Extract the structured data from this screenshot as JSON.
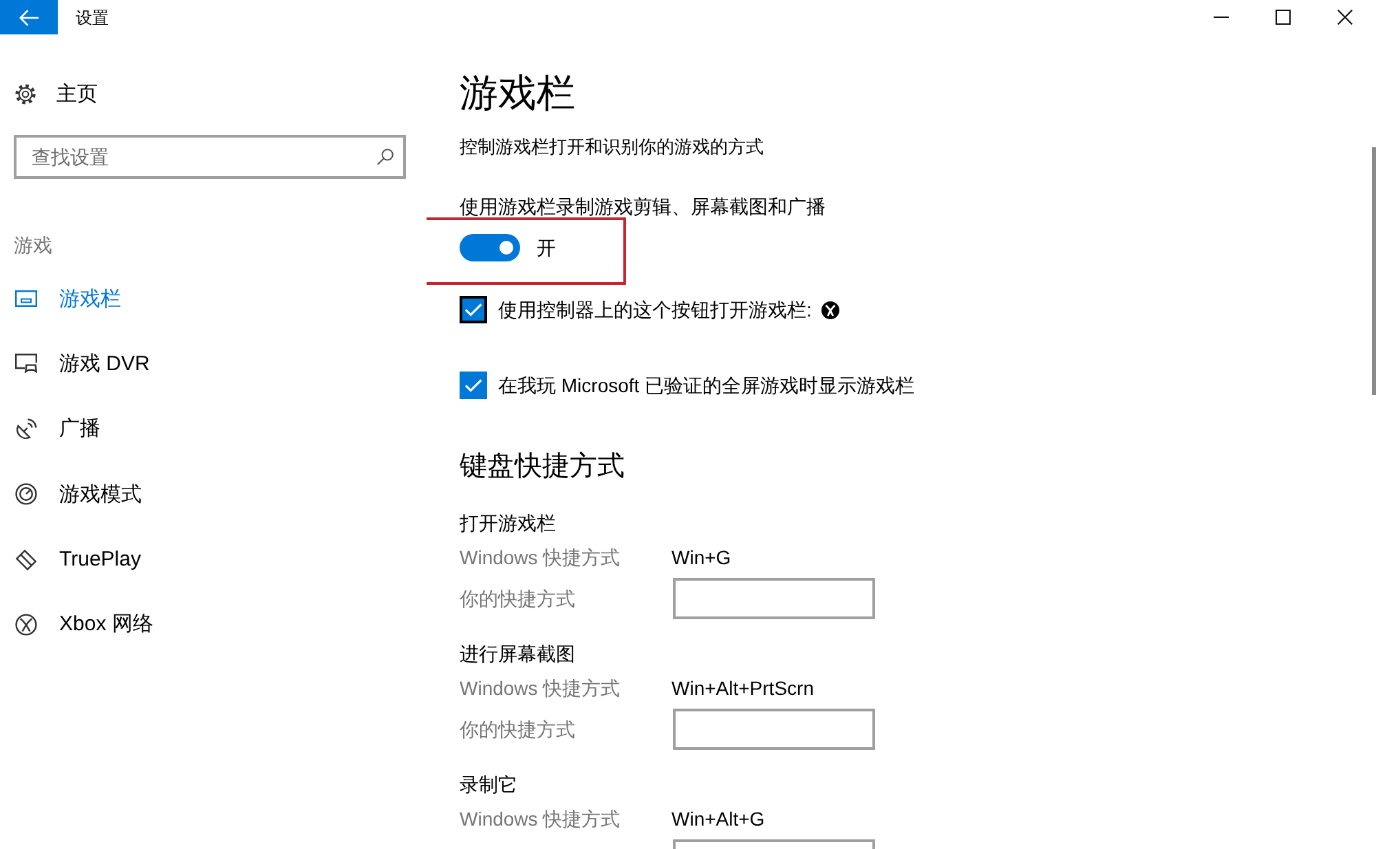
{
  "window": {
    "title": "设置"
  },
  "sidebar": {
    "home": "主页",
    "search": {
      "placeholder": "查找设置"
    },
    "section": "游戏",
    "items": [
      {
        "label": "游戏栏",
        "selected": true
      },
      {
        "label": "游戏 DVR",
        "selected": false
      },
      {
        "label": "广播",
        "selected": false
      },
      {
        "label": "游戏模式",
        "selected": false
      },
      {
        "label": "TruePlay",
        "selected": false
      },
      {
        "label": "Xbox 网络",
        "selected": false
      }
    ]
  },
  "main": {
    "title": "游戏栏",
    "description": "控制游戏栏打开和识别你的游戏的方式",
    "toggle": {
      "label": "使用游戏栏录制游戏剪辑、屏幕截图和广播",
      "on": true,
      "state_text": "开",
      "highlighted": true
    },
    "checkboxes": [
      {
        "label": "使用控制器上的这个按钮打开游戏栏:",
        "checked": true,
        "focused": true,
        "kind": "glyph"
      },
      {
        "label": "在我玩 Microsoft 已验证的全屏游戏时显示游戏栏",
        "checked": true,
        "focused": false,
        "kind": "plain"
      }
    ],
    "shortcuts": {
      "heading": "键盘快捷方式",
      "groups": [
        {
          "title": "打开游戏栏",
          "windows_label": "Windows 快捷方式",
          "windows_shortcut": "Win+G",
          "custom_label": "你的快捷方式"
        },
        {
          "title": "进行屏幕截图",
          "windows_label": "Windows 快捷方式",
          "windows_shortcut": "Win+Alt+PrtScrn",
          "custom_label": "你的快捷方式"
        },
        {
          "title": "录制它",
          "windows_label": "Windows 快捷方式",
          "windows_shortcut": "Win+Alt+G"
        }
      ]
    }
  }
}
